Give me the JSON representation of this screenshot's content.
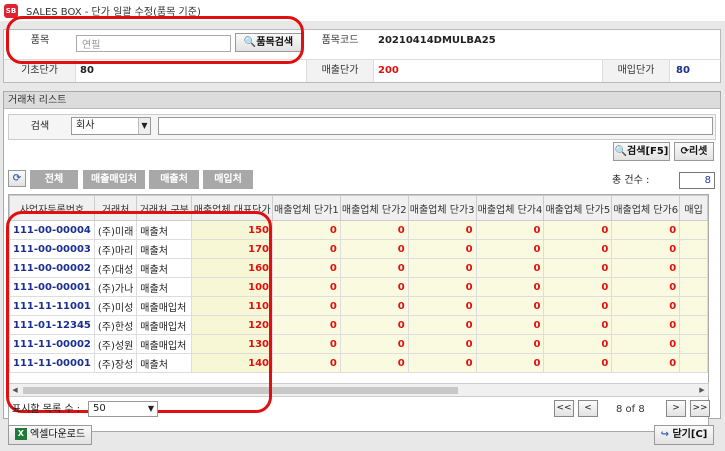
{
  "window": {
    "title": "SALES BOX - 단가 일괄 수정(품목 기준)",
    "logo_text": "SB"
  },
  "product_form": {
    "product_label": "품목",
    "product_value": "연필",
    "search_button": "품목검색",
    "code_label": "품목코드",
    "code_value": "20210414DMULBA25",
    "base_price_label": "기초단가",
    "base_price_value": "80",
    "sales_price_label": "매출단가",
    "sales_price_value": "200",
    "purchase_price_label": "매입단가",
    "purchase_price_value": "80"
  },
  "client_list": {
    "header": "거래처 리스트",
    "search_label": "검색",
    "search_field_option": "회사",
    "search_button": "검색[F5]",
    "reset_button": "리셋",
    "filters": [
      "전체",
      "매출매입처",
      "매출처",
      "매입처"
    ],
    "total_label": "총 건수 :",
    "total_value": "8"
  },
  "table": {
    "columns": [
      "사업자등록번호",
      "거래처",
      "거래처 구분",
      "매출업체 대표단가",
      "매출업체 단가1",
      "매출업체 단가2",
      "매출업체 단가3",
      "매출업체 단가4",
      "매출업체 단가5",
      "매출업체 단가6",
      "매입"
    ],
    "rows": [
      [
        "111-00-00004",
        "(주)미래",
        "매출처",
        "150",
        "0",
        "0",
        "0",
        "0",
        "0",
        "0"
      ],
      [
        "111-00-00003",
        "(주)마리",
        "매출처",
        "170",
        "0",
        "0",
        "0",
        "0",
        "0",
        "0"
      ],
      [
        "111-00-00002",
        "(주)대성",
        "매출처",
        "160",
        "0",
        "0",
        "0",
        "0",
        "0",
        "0"
      ],
      [
        "111-00-00001",
        "(주)가나",
        "매출처",
        "100",
        "0",
        "0",
        "0",
        "0",
        "0",
        "0"
      ],
      [
        "111-11-11001",
        "(주)미성",
        "매출매입처",
        "110",
        "0",
        "0",
        "0",
        "0",
        "0",
        "0"
      ],
      [
        "111-01-12345",
        "(주)한성",
        "매출매입처",
        "120",
        "0",
        "0",
        "0",
        "0",
        "0",
        "0"
      ],
      [
        "111-11-00002",
        "(주)성원",
        "매출매입처",
        "130",
        "0",
        "0",
        "0",
        "0",
        "0",
        "0"
      ],
      [
        "111-11-00001",
        "(주)장성",
        "매출처",
        "140",
        "0",
        "0",
        "0",
        "0",
        "0",
        "0"
      ]
    ]
  },
  "pager": {
    "rows_label": "표시할 목록 수 :",
    "rows_value": "50",
    "first": "<<",
    "prev": "<",
    "next": ">",
    "last": ">>",
    "page_info": "8 of 8"
  },
  "footer": {
    "excel_button": "엑셀다운로드",
    "close_button": "닫기[C]"
  },
  "colors": {
    "highlight": "#e01010",
    "code_blue": "#1a2f8f",
    "price_bg": "#fafae0"
  }
}
